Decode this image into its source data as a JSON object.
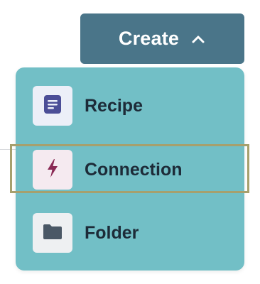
{
  "create_button": {
    "label": "Create",
    "chevron_icon": "chevron-up-icon"
  },
  "menu": {
    "items": [
      {
        "label": "Recipe",
        "icon": "document-icon",
        "icon_color": "#4b4e97",
        "tile_color": "#eceff8"
      },
      {
        "label": "Connection",
        "icon": "lightning-bolt-icon",
        "icon_color": "#8a2a55",
        "tile_color": "#f5eaf0",
        "highlighted": true
      },
      {
        "label": "Folder",
        "icon": "folder-icon",
        "icon_color": "#4a5866",
        "tile_color": "#eef0f2"
      }
    ]
  },
  "colors": {
    "button_bg": "#4a7589",
    "menu_bg": "#72bfc6",
    "highlight_border": "#a6a06d",
    "text": "#1d2b38"
  }
}
